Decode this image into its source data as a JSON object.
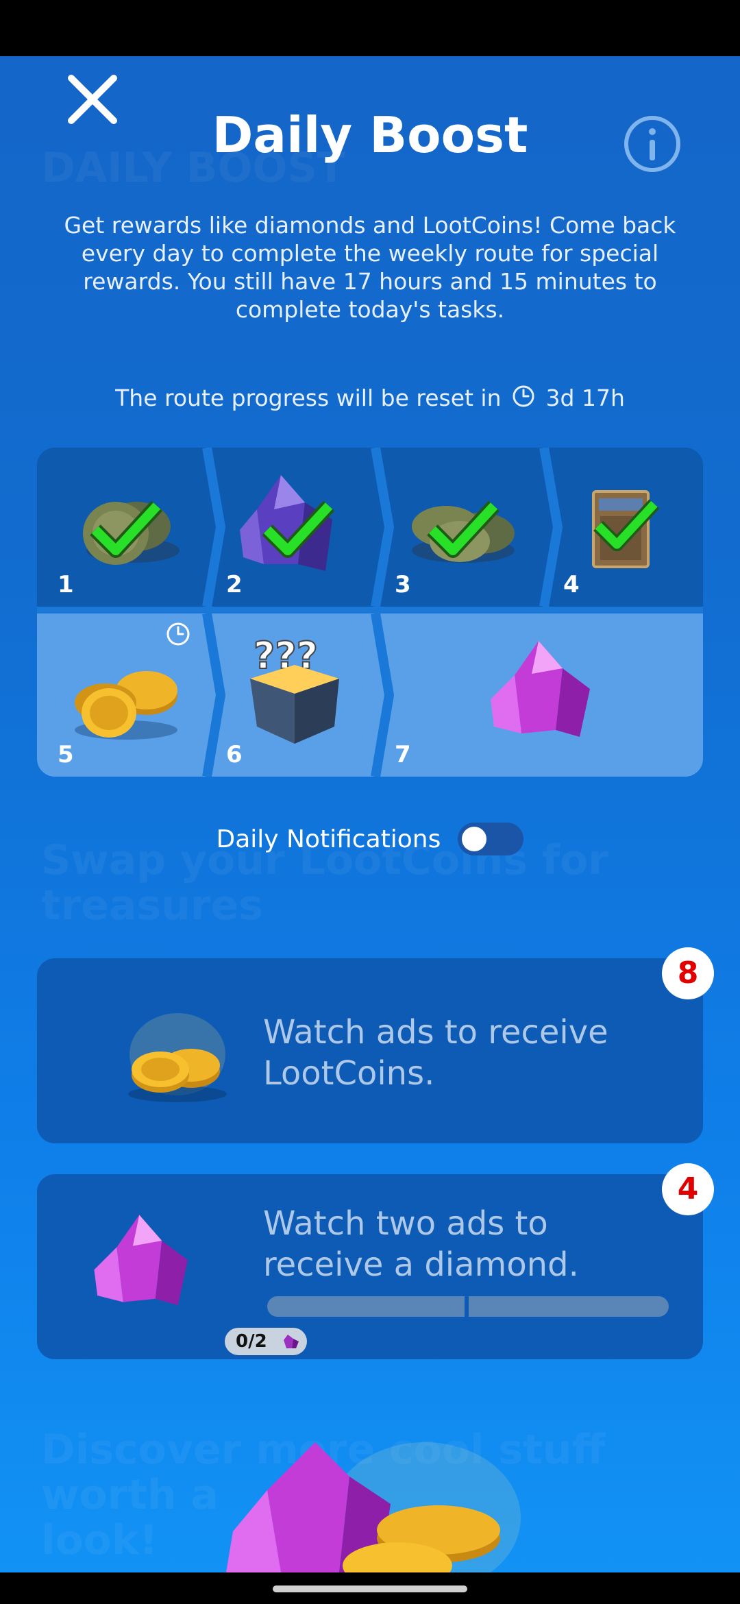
{
  "header": {
    "title": "Daily Boost",
    "description": "Get rewards like diamonds and LootCoins! Come back every day to complete the weekly route for special rewards. You still have 17 hours and 15 minutes to complete today's tasks.",
    "reset_prefix": "The route progress will be reset in",
    "reset_time": "3d 17h"
  },
  "route": {
    "days": [
      {
        "number": "1",
        "reward": "lootcoins-icon",
        "completed": true
      },
      {
        "number": "2",
        "reward": "diamond-icon",
        "completed": true
      },
      {
        "number": "3",
        "reward": "lootcoins-icon",
        "completed": true
      },
      {
        "number": "4",
        "reward": "card-icon",
        "completed": true
      },
      {
        "number": "5",
        "reward": "gold-coins-icon",
        "completed": false,
        "pending_clock": true
      },
      {
        "number": "6",
        "reward": "mystery-box-icon",
        "completed": false
      },
      {
        "number": "7",
        "reward": "pink-diamond-icon",
        "completed": false
      }
    ]
  },
  "notifications": {
    "label": "Daily Notifications",
    "enabled": false
  },
  "tasks": [
    {
      "text": "Watch ads to receive LootCoins.",
      "badge": "8"
    },
    {
      "text": "Watch two ads to receive a diamond.",
      "badge": "4",
      "progress": {
        "current": 0,
        "total": 2,
        "label": "0/2"
      }
    }
  ],
  "colors": {
    "background": "#1466c8",
    "card": "#0d5bb5",
    "badge_text": "#e10000",
    "check": "#1fdc1f"
  }
}
